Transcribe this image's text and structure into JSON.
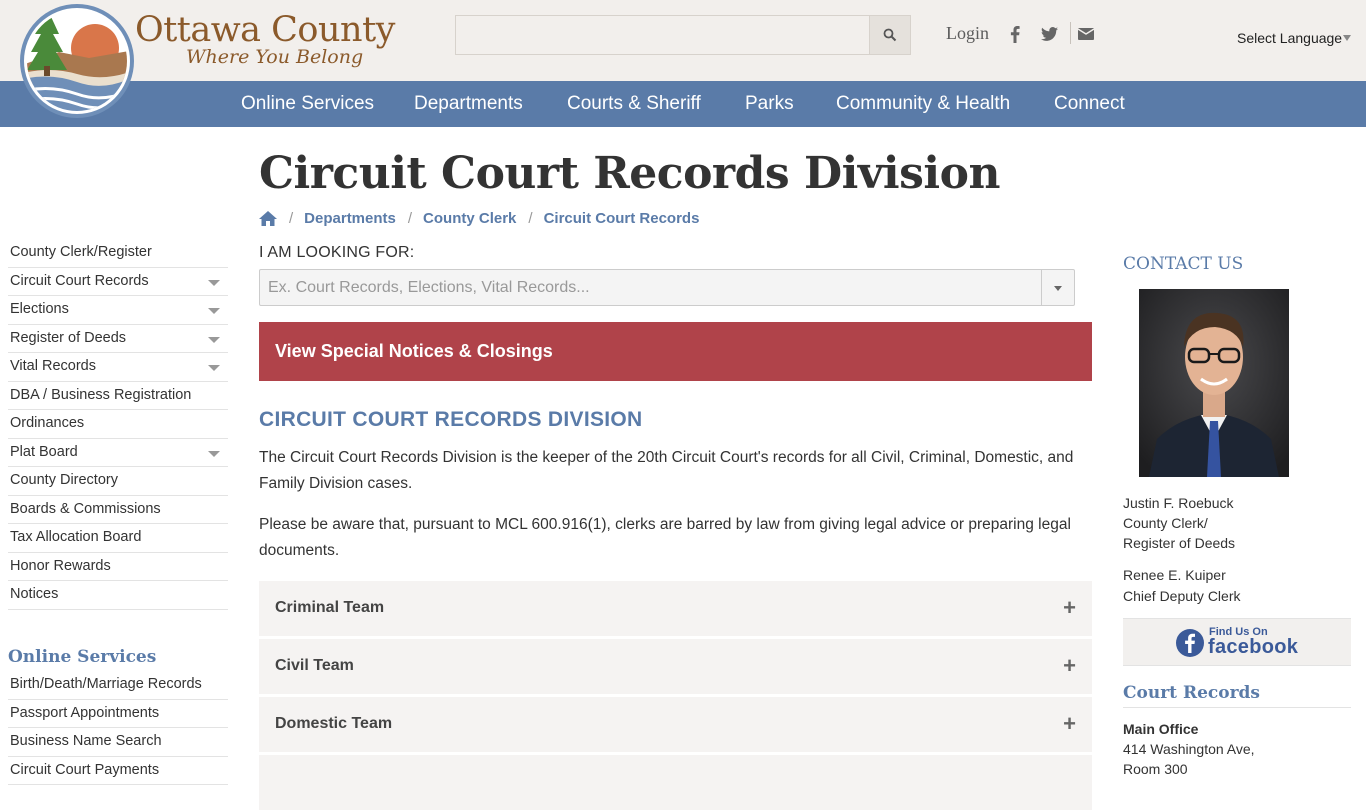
{
  "brand": {
    "name": "Ottawa County",
    "tagline": "Where You Belong"
  },
  "header": {
    "search_placeholder": "",
    "login": "Login",
    "language": "Select Language"
  },
  "icons": {
    "search": "search-icon",
    "facebook": "facebook-icon",
    "twitter": "twitter-icon",
    "email": "envelope-icon",
    "home": "home-icon"
  },
  "colors": {
    "nav": "#5a7ba8",
    "notice": "#b0434a",
    "brand": "#8b5a2b",
    "header_bg": "#f2efec"
  },
  "nav": [
    "Online Services",
    "Departments",
    "Courts & Sheriff",
    "Parks",
    "Community & Health",
    "Connect"
  ],
  "page": {
    "title": "Circuit Court Records Division",
    "breadcrumb": [
      "Departments",
      "County Clerk",
      "Circuit Court Records"
    ]
  },
  "sidebar": {
    "items": [
      {
        "label": "County Clerk/Register",
        "has_children": false
      },
      {
        "label": "Circuit Court Records",
        "has_children": true
      },
      {
        "label": "Elections",
        "has_children": true
      },
      {
        "label": "Register of Deeds",
        "has_children": true
      },
      {
        "label": "Vital Records",
        "has_children": true
      },
      {
        "label": "DBA / Business Registration",
        "has_children": false
      },
      {
        "label": "Ordinances",
        "has_children": false
      },
      {
        "label": "Plat Board",
        "has_children": true
      },
      {
        "label": "County Directory",
        "has_children": false
      },
      {
        "label": "Boards & Commissions",
        "has_children": false
      },
      {
        "label": "Tax Allocation Board",
        "has_children": false
      },
      {
        "label": "Honor Rewards",
        "has_children": false
      },
      {
        "label": "Notices",
        "has_children": false
      }
    ],
    "online_heading": "Online Services",
    "online_items": [
      "Birth/Death/Marriage Records",
      "Passport Appointments",
      "Business Name Search",
      "Circuit Court Payments"
    ]
  },
  "main": {
    "looking_label": "I AM LOOKING FOR:",
    "looking_placeholder": "Ex. Court Records, Elections, Vital Records...",
    "notice": "View Special Notices & Closings",
    "section_title": "CIRCUIT COURT RECORDS DIVISION",
    "paragraphs": [
      "The Circuit Court Records Division is the keeper of the 20th Circuit Court's records for all Civil, Criminal, Domestic, and Family Division cases.",
      "Please be aware that, pursuant to MCL 600.916(1), clerks are barred by law from giving legal advice or preparing legal documents."
    ],
    "accordion": [
      "Criminal Team",
      "Civil Team",
      "Domestic Team"
    ]
  },
  "contact": {
    "heading": "CONTACT US",
    "person1": {
      "name": "Justin F. Roebuck",
      "title1": "County Clerk/",
      "title2": "Register of Deeds"
    },
    "person2": {
      "name": "Renee E. Kuiper",
      "title": "Chief Deputy Clerk"
    },
    "facebook": {
      "line1": "Find Us On",
      "line2": "facebook"
    },
    "court_heading": "Court Records",
    "main_office": "Main Office",
    "address1": "414 Washington Ave,",
    "address2": "Room 300"
  }
}
